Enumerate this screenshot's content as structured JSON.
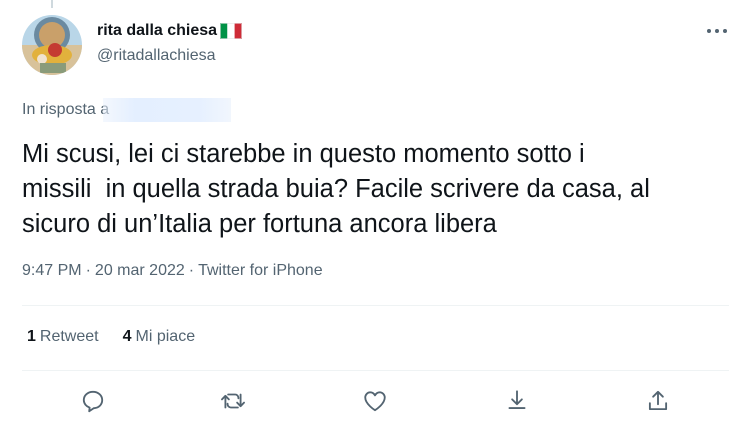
{
  "tweet": {
    "author": {
      "display_name": "rita dalla chiesa",
      "handle": "@ritadallachiesa",
      "flag_icon": "italy-flag-icon"
    },
    "reply_prefix": "In risposta a",
    "text": "Mi scusi, lei ci starebbe in questo momento sotto i\nmissili  in quella strada buia? Facile scrivere da casa, al\nsicuro di un’Italia per fortuna ancora libera",
    "time": "9:47 PM",
    "date": "20 mar 2022",
    "source": "Twitter for iPhone",
    "separator": "·"
  },
  "stats": {
    "retweets": {
      "count": "1",
      "label": "Retweet"
    },
    "likes": {
      "count": "4",
      "label": "Mi piace"
    }
  },
  "actions": [
    "reply-icon",
    "retweet-icon",
    "like-icon",
    "bookmark-icon",
    "share-icon"
  ],
  "colors": {
    "text_primary": "#0f1419",
    "text_secondary": "#536471",
    "divider": "#eff3f4",
    "flag_green": "#009246",
    "flag_white": "#ffffff",
    "flag_red": "#ce2b37"
  }
}
